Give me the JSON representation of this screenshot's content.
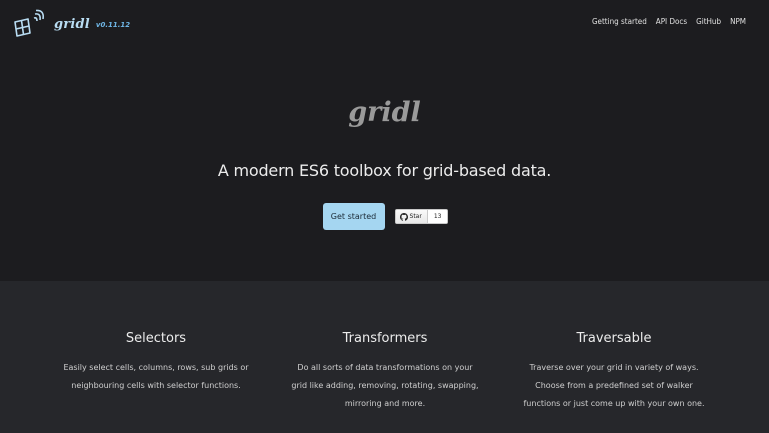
{
  "brand": {
    "name": "gridl",
    "version": "v0.11.12",
    "logo_icon": "grid-signal-icon"
  },
  "nav": {
    "links": [
      {
        "label": "Getting started"
      },
      {
        "label": "API Docs"
      },
      {
        "label": "GitHub"
      },
      {
        "label": "NPM"
      }
    ]
  },
  "hero": {
    "title": "gridl",
    "tagline": "A modern ES6 toolbox for grid-based data.",
    "cta_label": "Get started",
    "star_label": "Star",
    "star_count": "13",
    "star_icon": "github-icon"
  },
  "features": [
    {
      "title": "Selectors",
      "description": "Easily select cells, columns, rows, sub grids or\nneighbouring cells with selector functions."
    },
    {
      "title": "Transformers",
      "description": "Do all sorts of data transformations on your\ngrid like adding, removing, rotating, swapping,\nmirroring and more."
    },
    {
      "title": "Traversable",
      "description": "Traverse over your grid in variety of ways.\nChoose from a predefined set of walker\nfunctions or just come up with your own one."
    }
  ],
  "colors": {
    "background": "#1c1c1f",
    "features_background": "#26272b",
    "accent": "#a5d6f1",
    "brand": "#b8dcf2"
  }
}
